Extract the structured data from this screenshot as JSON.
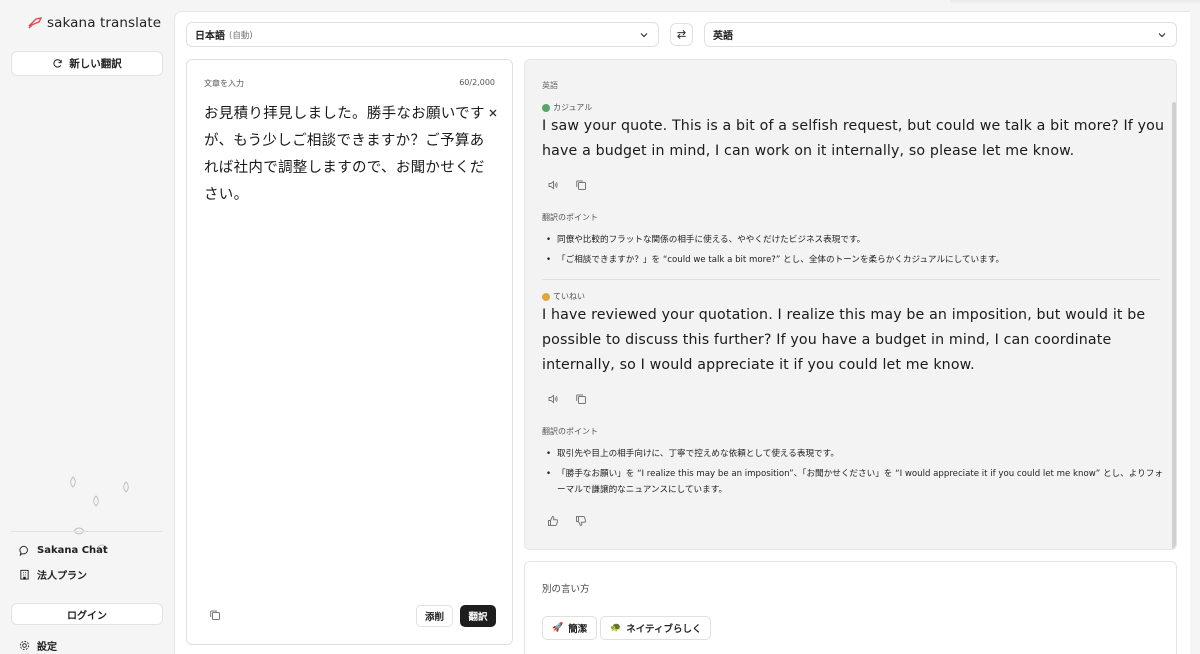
{
  "app": {
    "name": "sakana translate"
  },
  "sidebar": {
    "new_translation": "新しい翻訳",
    "links": [
      {
        "label": "Sakana Chat"
      },
      {
        "label": "法人プラン"
      }
    ],
    "login": "ログイン",
    "settings": "設定"
  },
  "languages": {
    "source": "日本語",
    "source_note": "(自動)",
    "target": "英語"
  },
  "input": {
    "label": "文章を入力",
    "char_count": "60/2,000",
    "text": "お見積り拝見しました。勝手なお願いですが、もう少しご相談できますか？ご予算あれば社内で調整しますので、お聞かせください。",
    "polish_button": "添削",
    "translate_button": "翻訳"
  },
  "output": {
    "language": "英語",
    "results": [
      {
        "tone": "カジュアル",
        "tone_color": "#5aa469",
        "text": "I saw your quote. This is a bit of a selfish request, but could we talk a bit more? If you have a budget in mind, I can work on it internally, so please let me know.",
        "points_heading": "翻訳のポイント",
        "points": [
          "同僚や比較的フラットな関係の相手に使える、ややくだけたビジネス表現です。",
          "「ご相談できますか？」を “could we talk a bit more?” とし、全体のトーンを柔らかくカジュアルにしています。"
        ]
      },
      {
        "tone": "ていねい",
        "tone_color": "#e0a83a",
        "text": "I have reviewed your quotation. I realize this may be an imposition, but would it be possible to discuss this further? If you have a budget in mind, I can coordinate internally, so I would appreciate it if you could let me know.",
        "points_heading": "翻訳のポイント",
        "points": [
          "取引先や目上の相手向けに、丁寧で控えめな依頼として使える表現です。",
          "「勝手なお願い」を “I realize this may be an imposition”、「お聞かせください」を “I would appreciate it if you could let me know” とし、よりフォーマルで謙譲的なニュアンスにしています。"
        ]
      }
    ]
  },
  "alternatives": {
    "title": "別の言い方",
    "chips": [
      {
        "label": "簡潔",
        "emoji": "🚀"
      },
      {
        "label": "ネイティブらしく",
        "emoji": "🐢"
      }
    ]
  },
  "colors": {
    "accent": "#e8474c",
    "primary_button": "#1e1e1e"
  }
}
